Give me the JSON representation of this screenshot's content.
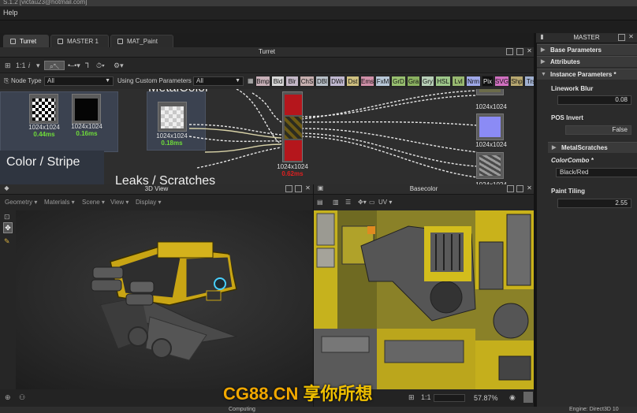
{
  "app": {
    "title": "S.1.2 [victau23@hotmail.com]"
  },
  "menu": {
    "help": "Help"
  },
  "tabs": [
    {
      "label": "Turret"
    },
    {
      "label": "MASTER 1"
    },
    {
      "label": "MAT_Paint"
    }
  ],
  "graph": {
    "panel_title": "Turret",
    "toolbar": {
      "zoom_label": "1:1",
      "info": "i"
    },
    "filter": {
      "node_type_label": "Node Type",
      "node_type_value": "All",
      "custom_params_label": "Using Custom Parameters",
      "custom_params_value": "All"
    },
    "chips": [
      {
        "label": "Bmp",
        "color": "#c8b0b8"
      },
      {
        "label": "Bld",
        "color": "#d8d8d8"
      },
      {
        "label": "Blr",
        "color": "#c4b8c8"
      },
      {
        "label": "ChS",
        "color": "#c8b0b0"
      },
      {
        "label": "DBl",
        "color": "#b8c0c8"
      },
      {
        "label": "DWr",
        "color": "#c0b8d0"
      },
      {
        "label": "Dst",
        "color": "#cfc080"
      },
      {
        "label": "Ems",
        "color": "#d090a8"
      },
      {
        "label": "FxM",
        "color": "#b8c8d8"
      },
      {
        "label": "GrD",
        "color": "#98c070"
      },
      {
        "label": "Gra",
        "color": "#8ab060"
      },
      {
        "label": "Gry",
        "color": "#b8d0b8"
      },
      {
        "label": "HSL",
        "color": "#9ec88a"
      },
      {
        "label": "Lvl",
        "color": "#98b870"
      },
      {
        "label": "Nrm",
        "color": "#9fa8e8"
      },
      {
        "label": "Pix",
        "color": "#101010"
      },
      {
        "label": "SVG",
        "color": "#d070c0"
      },
      {
        "label": "Shp",
        "color": "#b8a870"
      },
      {
        "label": "Trs",
        "color": "#a0b0d0"
      }
    ],
    "frame_titles": {
      "f1": "MetalColor",
      "f2": "Color / Stripe",
      "f3": "Leaks / Scratches"
    },
    "nodes": [
      {
        "size": "1024x1024",
        "time": "0.44ms"
      },
      {
        "size": "1024x1024",
        "time": "0.16ms"
      },
      {
        "size": "1024x1024",
        "time": "0.18ms"
      }
    ],
    "output_nodes": [
      {
        "size": "1024x1024"
      },
      {
        "size": "1024x1024"
      },
      {
        "size": "1024x1024"
      }
    ],
    "blend_node": {
      "size": "1024x1024",
      "time": "0.62ms"
    }
  },
  "view3d": {
    "title": "3D View",
    "menu": [
      "Geometry",
      "Materials",
      "Scene",
      "View",
      "Display"
    ]
  },
  "basecolor": {
    "title": "Basecolor",
    "uv_label": "UV",
    "zoom_ratio": "1:1",
    "zoom_percent": "57.87%"
  },
  "parameters": {
    "panel_title": "MASTER",
    "sections": {
      "base": "Base Parameters",
      "attributes": "Attributes",
      "instance": "Instance Parameters *",
      "metal": "MetalScratches"
    },
    "linework_blur": {
      "label": "Linework Blur",
      "value": "0.08"
    },
    "pos_invert": {
      "label": "POS Invert",
      "value": "False"
    },
    "color_combo": {
      "label": "ColorCombo *",
      "value": "Black/Red"
    },
    "paint_tiling": {
      "label": "Paint Tiling",
      "value": "2.55"
    }
  },
  "status": {
    "center": "Computing",
    "right": "Engine: Direct3D 10"
  },
  "watermark": {
    "latin": "CG88.CN",
    "cjk": "享你所想"
  },
  "colors": {
    "accent_green": "#6fdc3a",
    "panel": "#2b2b2b",
    "highlight_red": "#b5161c",
    "texture_yellow": "#c9b41a"
  }
}
